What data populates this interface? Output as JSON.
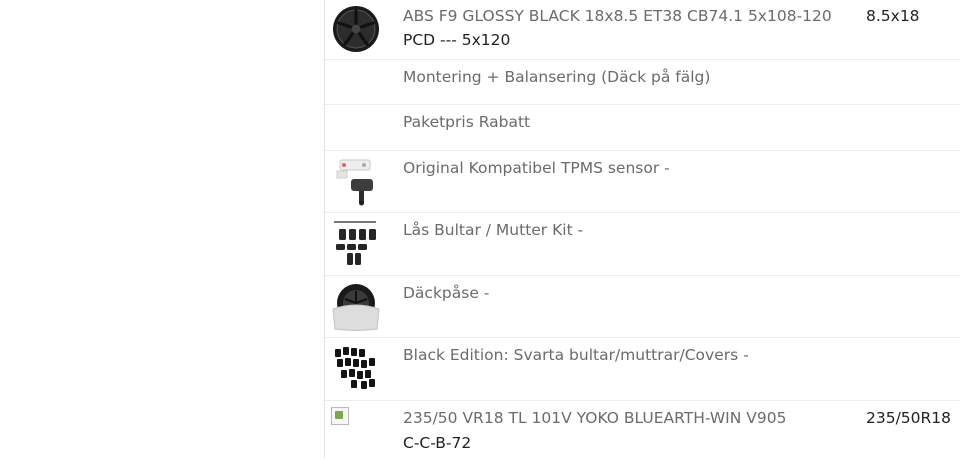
{
  "rows": [
    {
      "name": "ABS F9 GLOSSY BLACK 18x8.5 ET38 CB74.1 5x108-120",
      "sub": "PCD --- 5x120",
      "size": "8.5x18",
      "icon": "wheel-rim-icon"
    },
    {
      "name": "Montering + Balansering (Däck på fälg)"
    },
    {
      "name": "Paketpris Rabatt"
    },
    {
      "name": "Original Kompatibel TPMS sensor -",
      "icon": "tpms-sensor-icon"
    },
    {
      "name": "Lås Bultar / Mutter Kit -",
      "icon": "lock-bolts-icon"
    },
    {
      "name": "Däckpåse -",
      "icon": "tire-bag-icon"
    },
    {
      "name": "Black Edition: Svarta bultar/muttrar/Covers -",
      "icon": "black-bolts-icon"
    },
    {
      "name": "235/50 VR18 TL 101V YOKO BLUEARTH-WIN V905",
      "sub": "C-C-B-72",
      "size": "235/50R18",
      "icon": "broken-image-icon"
    }
  ]
}
